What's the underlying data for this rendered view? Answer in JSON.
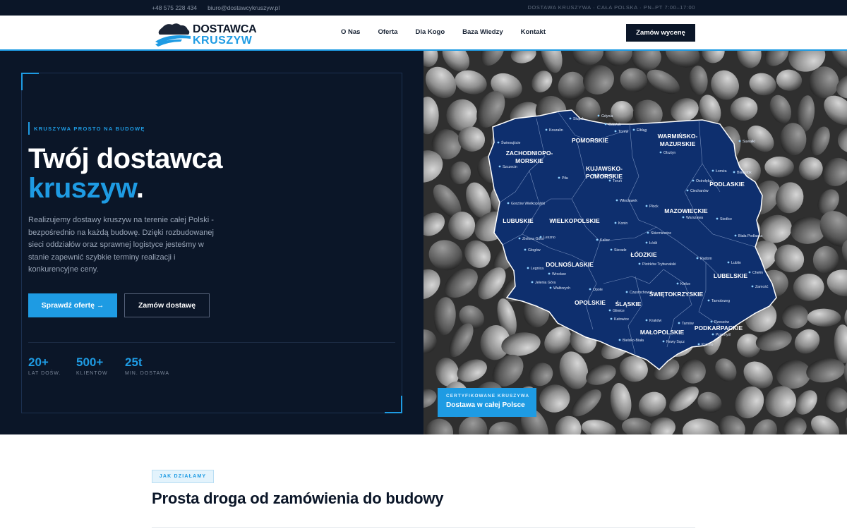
{
  "topbar": {
    "phone": "+48 575 228 434",
    "email": "biuro@dostawcykruszyw.pl",
    "tagline": "DOSTAWA KRUSZYWA · CAŁA POLSKA · PN–PT 7:00–17:00"
  },
  "header": {
    "logo_line1": "DOSTAWCA",
    "logo_line2": "KRUSZYW",
    "nav": [
      "O Nas",
      "Oferta",
      "Dla Kogo",
      "Baza Wiedzy",
      "Kontakt"
    ],
    "cta": "Zamów wycenę"
  },
  "hero": {
    "eyebrow": "KRUSZYWA PROSTO NA BUDOWĘ",
    "title_line1": "Twój dostawca",
    "title_accent": "kruszyw",
    "title_end": ".",
    "lead": "Realizujemy dostawy kruszyw na terenie całej Polski - bezpośrednio na każdą budowę. Dzięki rozbudowanej sieci oddziałów oraz sprawnej logistyce jesteśmy w stanie zapewnić szybkie terminy realizacji i konkurencyjne ceny.",
    "btn_primary": "Sprawdź ofertę →",
    "btn_secondary": "Zamów dostawę",
    "stats": [
      {
        "value": "20+",
        "label": "LAT DOŚW."
      },
      {
        "value": "500+",
        "label": "KLIENTÓW"
      },
      {
        "value": "25t",
        "label": "MIN. DOSTAWA"
      }
    ]
  },
  "map": {
    "regions": [
      {
        "name": "ZACHODNIOPO-",
        "name2": "MORSKIE"
      },
      {
        "name": "POMORSKIE"
      },
      {
        "name": "WARMIŃSKO-",
        "name2": "MAZURSKIE"
      },
      {
        "name": "KUJAWSKO-",
        "name2": "POMORSKIE"
      },
      {
        "name": "PODLASKIE"
      },
      {
        "name": "LUBUSKIE"
      },
      {
        "name": "WIELKOPOLSKIE"
      },
      {
        "name": "MAZOWIECKIE"
      },
      {
        "name": "ŁÓDZKIE"
      },
      {
        "name": "DOLNOŚLASKIE"
      },
      {
        "name": "LUBELSKIE"
      },
      {
        "name": "OPOLSKIE"
      },
      {
        "name": "ŚLĄSKIE"
      },
      {
        "name": "ŚWIĘTOKRZYSKIE"
      },
      {
        "name": "MAŁOPOLSKIE"
      },
      {
        "name": "PODKARPACKIE"
      }
    ],
    "cities": [
      "Słupsk",
      "Gdynia",
      "Gdańsk",
      "Koszalin",
      "Tczew",
      "Elbląg",
      "Suwałki",
      "Świnoujście",
      "Olsztyn",
      "Szczecin",
      "Bydgoszcz",
      "Łomża",
      "Białystok",
      "Piła",
      "Toruń",
      "Ostrołęka",
      "Ciechanów",
      "Gorzów Wielkopolski",
      "Włocławek",
      "Płock",
      "Konin",
      "Warszawa",
      "Siedlce",
      "Skierniewice",
      "Biała Podlaska",
      "Zielona Góra",
      "Leszno",
      "Kalisz",
      "Łódź",
      "Sieradz",
      "Głogów",
      "Radom",
      "Legnica",
      "Piotrków Trybunalski",
      "Lublin",
      "Wrocław",
      "Chełm",
      "Jelenia Góra",
      "Wałbrzych",
      "Kielce",
      "Opole",
      "Częstochowa",
      "Zamość",
      "Tarnobrzeg",
      "Gliwice",
      "Katowice",
      "Rzeszów",
      "Kraków",
      "Tarnów",
      "Przemyśl",
      "Bielsko-Biała",
      "Nowy Sącz",
      "Krosno"
    ]
  },
  "badge": {
    "kicker": "CERTYFIKOWANE KRUSZYWA",
    "text": "Dostawa w całej Polsce"
  },
  "section": {
    "tag": "JAK DZIAŁAMY",
    "title": "Prosta droga od zamówienia do budowy"
  },
  "colors": {
    "navy": "#0b1628",
    "accent": "#1e9be3",
    "map": "#0e2f6e"
  }
}
